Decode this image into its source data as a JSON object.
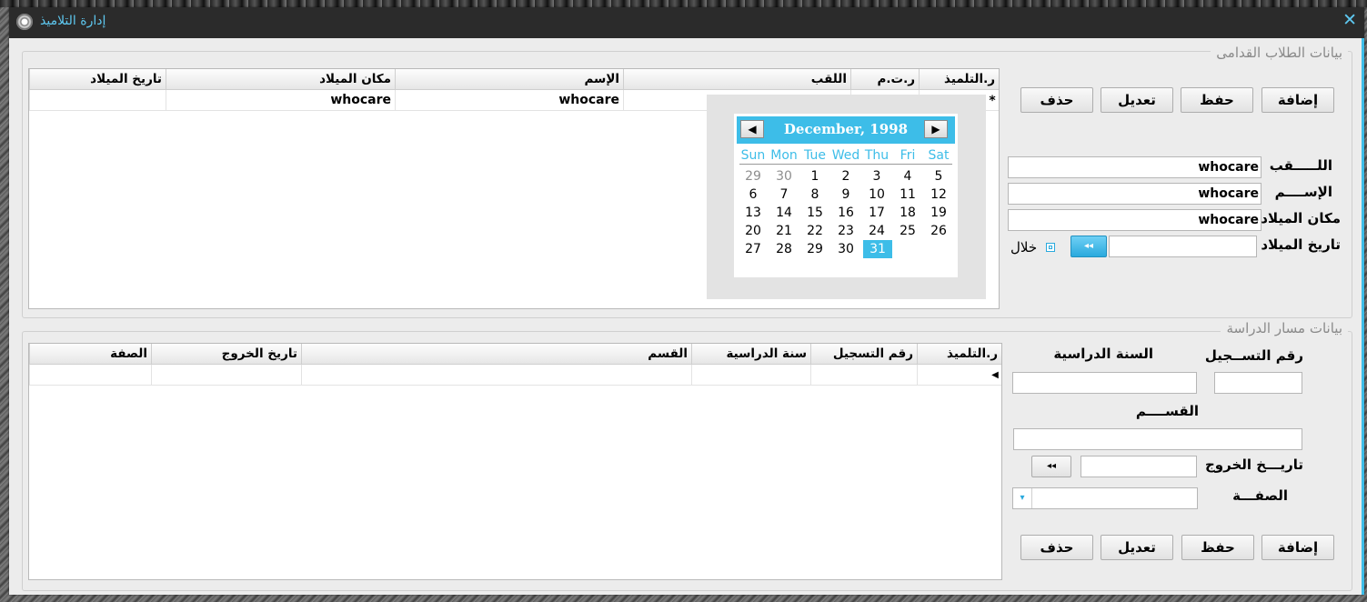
{
  "window": {
    "title": "إدارة التلاميذ",
    "close": "✕"
  },
  "group1": {
    "legend": "بيانات الطلاب القدامى",
    "grid": {
      "headers": [
        "ر.التلميذ",
        "ر.ت.م",
        "اللقب",
        "الإسم",
        "مكان الميلاد",
        "تاريخ الميلاد"
      ],
      "row_marker": "*",
      "rows": [
        [
          "",
          "",
          "",
          "whocare",
          "whocare",
          ""
        ]
      ]
    },
    "buttons": {
      "add": "إضافة",
      "save": "حفظ",
      "edit": "تعديل",
      "delete": "حذف"
    },
    "form": {
      "lastname_label": "اللـــــقب",
      "lastname_value": "whocare",
      "name_label": "الإســــم",
      "name_value": "whocare",
      "birthplace_label": "مكان الميلاد",
      "birthplace_value": "whocare",
      "birthdate_label": "تاريخ الميلاد",
      "birthdate_value": "",
      "date_btn": "◂◂",
      "during_label": "خلال"
    },
    "calendar": {
      "month_label": "December, 1998",
      "prev": "◀",
      "next": "▶",
      "weekdays": [
        "Sun",
        "Mon",
        "Tue",
        "Wed",
        "Thu",
        "Fri",
        "Sat"
      ],
      "weeks": [
        [
          "29",
          "30",
          "1",
          "2",
          "3",
          "4",
          "5"
        ],
        [
          "6",
          "7",
          "8",
          "9",
          "10",
          "11",
          "12"
        ],
        [
          "13",
          "14",
          "15",
          "16",
          "17",
          "18",
          "19"
        ],
        [
          "20",
          "21",
          "22",
          "23",
          "24",
          "25",
          "26"
        ],
        [
          "27",
          "28",
          "29",
          "30",
          "31",
          "",
          ""
        ]
      ],
      "selected": "31"
    }
  },
  "group2": {
    "legend": "بيانات مسار الدراسة",
    "grid": {
      "headers": [
        "ر.التلميذ",
        "رقم التسجيل",
        "سنة الدراسية",
        "القسم",
        "تاريخ الخروج",
        "الصفة"
      ],
      "row_marker": "◀"
    },
    "form": {
      "reg_label": "رقم التســجيل",
      "year_label": "السنة الدراسية",
      "dept_label": "القســــم",
      "exit_label": "تاريـــخ الخروج",
      "status_label": "الصفـــة",
      "date_btn": "◂◂",
      "combo_arrow": "▾"
    },
    "buttons": {
      "add": "إضافة",
      "save": "حفظ",
      "edit": "تعديل",
      "delete": "حذف"
    }
  }
}
